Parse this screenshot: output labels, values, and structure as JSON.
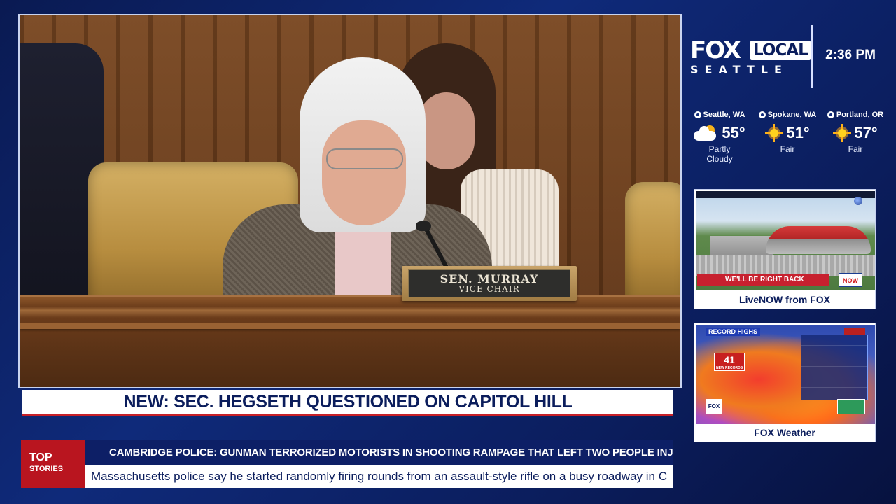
{
  "video": {
    "nameplate": {
      "name": "SEN. MURRAY",
      "title": "VICE CHAIR"
    }
  },
  "brand": {
    "fox": "FOX",
    "local": "LOCAL",
    "city": "SEATTLE",
    "time": "2:36 PM"
  },
  "weather": [
    {
      "city": "Seattle, WA",
      "temp": "55°",
      "desc": "Partly Cloudy",
      "icon": "partly-cloudy-icon"
    },
    {
      "city": "Spokane, WA",
      "temp": "51°",
      "desc": "Fair",
      "icon": "sun-icon"
    },
    {
      "city": "Portland, OR",
      "temp": "57°",
      "desc": "Fair",
      "icon": "sun-icon"
    }
  ],
  "promos": {
    "live": {
      "label": "LiveNOW from FOX",
      "banner": "WE'LL BE RIGHT BACK",
      "badge": "NOW"
    },
    "weather": {
      "label": "FOX Weather",
      "map_title": "RECORD HIGHS",
      "count": "41",
      "count_caption": "NEW RECORDS"
    }
  },
  "headline": "NEW: SEC. HEGSETH QUESTIONED ON CAPITOL HILL",
  "ticker": {
    "label_line1": "TOP",
    "label_line2": "STORIES",
    "headline": "CAMBRIDGE POLICE: GUNMAN TERRORIZED MOTORISTS IN SHOOTING RAMPAGE THAT LEFT TWO PEOPLE INJURED",
    "crawl": "Massachusetts police say he started randomly firing rounds from an assault-style rifle on a busy roadway in C"
  },
  "colors": {
    "background": "#0f2a7a",
    "accent_red": "#c72028",
    "navy_text": "#0b1d5c"
  }
}
